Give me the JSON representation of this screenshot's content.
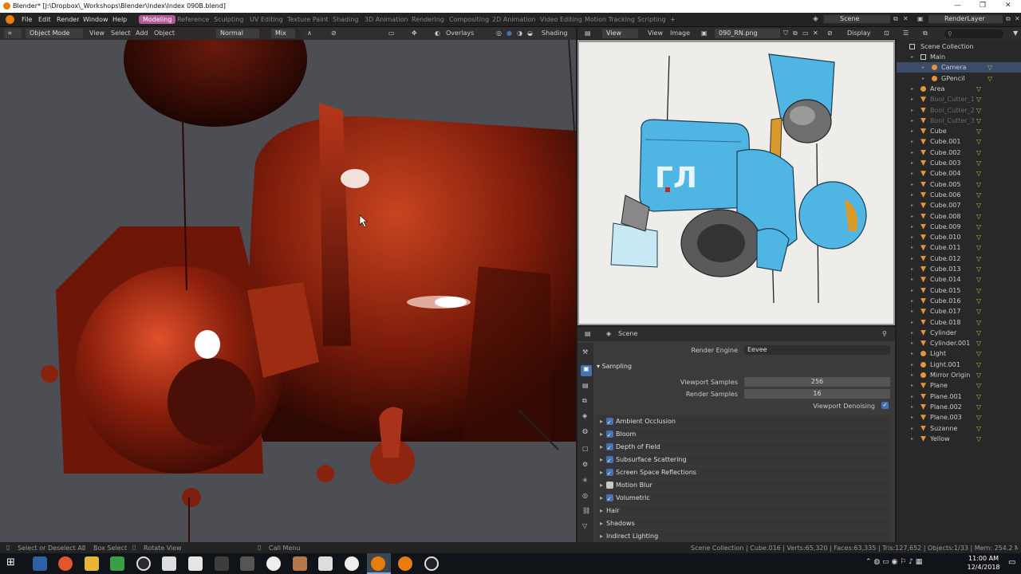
{
  "window": {
    "title": "Blender* [J:\\Dropbox\\_Workshops\\Blender\\Index\\Index 090B.blend]"
  },
  "menus": [
    "File",
    "Edit",
    "Render",
    "Window",
    "Help"
  ],
  "workspaces": [
    "Modeling",
    "Reference",
    "Sculpting",
    "UV Editing",
    "Texture Paint",
    "Shading",
    "3D Animation",
    "Rendering",
    "Compositing",
    "2D Animation",
    "Video Editing",
    "Motion Tracking",
    "Scripting"
  ],
  "active_workspace": "Modeling",
  "scene_name": "Scene",
  "render_layer": "RenderLayer",
  "viewport": {
    "mode": "Object Mode",
    "menu": [
      "View",
      "Select",
      "Add",
      "Object"
    ],
    "orientation": "Normal",
    "pivot": "Mix",
    "overlays": "Overlays",
    "shading": "Shading"
  },
  "image_editor": {
    "view": "View",
    "menu": [
      "View",
      "Image"
    ],
    "image_name": "090_RN.png",
    "display": "Display"
  },
  "properties": {
    "context": "Scene",
    "render_engine_label": "Render Engine",
    "render_engine": "Eevee",
    "sampling_label": "Sampling",
    "viewport_samples_label": "Viewport Samples",
    "viewport_samples": "256",
    "render_samples_label": "Render Samples",
    "render_samples": "16",
    "viewport_denoising_label": "Viewport Denoising",
    "panels": [
      {
        "label": "Ambient Occlusion",
        "checked": true
      },
      {
        "label": "Bloom",
        "checked": true
      },
      {
        "label": "Depth of Field",
        "checked": true
      },
      {
        "label": "Subsurface Scattering",
        "checked": true
      },
      {
        "label": "Screen Space Reflections",
        "checked": true
      },
      {
        "label": "Motion Blur",
        "checked": false
      },
      {
        "label": "Volumetric",
        "checked": true
      }
    ],
    "plain_panels": [
      "Hair",
      "Shadows",
      "Indirect Lighting"
    ]
  },
  "outliner": {
    "root": "Scene Collection",
    "items": [
      {
        "label": "Main",
        "type": "collection"
      },
      {
        "label": "Camera",
        "type": "camera",
        "selected": true
      },
      {
        "label": "GPencil",
        "type": "gpencil"
      },
      {
        "label": "Area",
        "type": "light"
      },
      {
        "label": "Bool_Cutter_1",
        "type": "mesh",
        "dim": true
      },
      {
        "label": "Bool_Cutter_2",
        "type": "mesh",
        "dim": true
      },
      {
        "label": "Bool_Cutter_3",
        "type": "mesh",
        "dim": true
      },
      {
        "label": "Cube",
        "type": "mesh"
      },
      {
        "label": "Cube.001",
        "type": "mesh"
      },
      {
        "label": "Cube.002",
        "type": "mesh"
      },
      {
        "label": "Cube.003",
        "type": "mesh"
      },
      {
        "label": "Cube.004",
        "type": "mesh"
      },
      {
        "label": "Cube.005",
        "type": "mesh"
      },
      {
        "label": "Cube.006",
        "type": "mesh"
      },
      {
        "label": "Cube.007",
        "type": "mesh"
      },
      {
        "label": "Cube.008",
        "type": "mesh"
      },
      {
        "label": "Cube.009",
        "type": "mesh"
      },
      {
        "label": "Cube.010",
        "type": "mesh"
      },
      {
        "label": "Cube.011",
        "type": "mesh"
      },
      {
        "label": "Cube.012",
        "type": "mesh"
      },
      {
        "label": "Cube.013",
        "type": "mesh"
      },
      {
        "label": "Cube.014",
        "type": "mesh"
      },
      {
        "label": "Cube.015",
        "type": "mesh"
      },
      {
        "label": "Cube.016",
        "type": "mesh"
      },
      {
        "label": "Cube.017",
        "type": "mesh"
      },
      {
        "label": "Cube.018",
        "type": "mesh"
      },
      {
        "label": "Cylinder",
        "type": "mesh"
      },
      {
        "label": "Cylinder.001",
        "type": "mesh"
      },
      {
        "label": "Light",
        "type": "light"
      },
      {
        "label": "Light.001",
        "type": "light"
      },
      {
        "label": "Mirror Origin",
        "type": "empty"
      },
      {
        "label": "Plane",
        "type": "mesh"
      },
      {
        "label": "Plane.001",
        "type": "mesh"
      },
      {
        "label": "Plane.002",
        "type": "mesh"
      },
      {
        "label": "Plane.003",
        "type": "mesh"
      },
      {
        "label": "Suzanne",
        "type": "mesh"
      },
      {
        "label": "Yellow",
        "type": "mesh"
      }
    ]
  },
  "status": {
    "hint1": "Select or Deselect All",
    "hint2": "Box Select",
    "hint3": "Rotate View",
    "hint4": "Call Menu",
    "stats": "Scene Collection | Cube.016 | Verts:65,320 | Faces:63,335 | Tris:127,652 | Objects:1/33 | Mem: 254.2 MB | v2.80.35"
  },
  "clock": {
    "time": "11:00 AM",
    "date": "12/4/2018"
  },
  "colors": {
    "accent": "#4772b3",
    "workspace_active": "#b35a9b",
    "mesh_orange": "#e8923a",
    "selected_row": "#3b4b68"
  }
}
